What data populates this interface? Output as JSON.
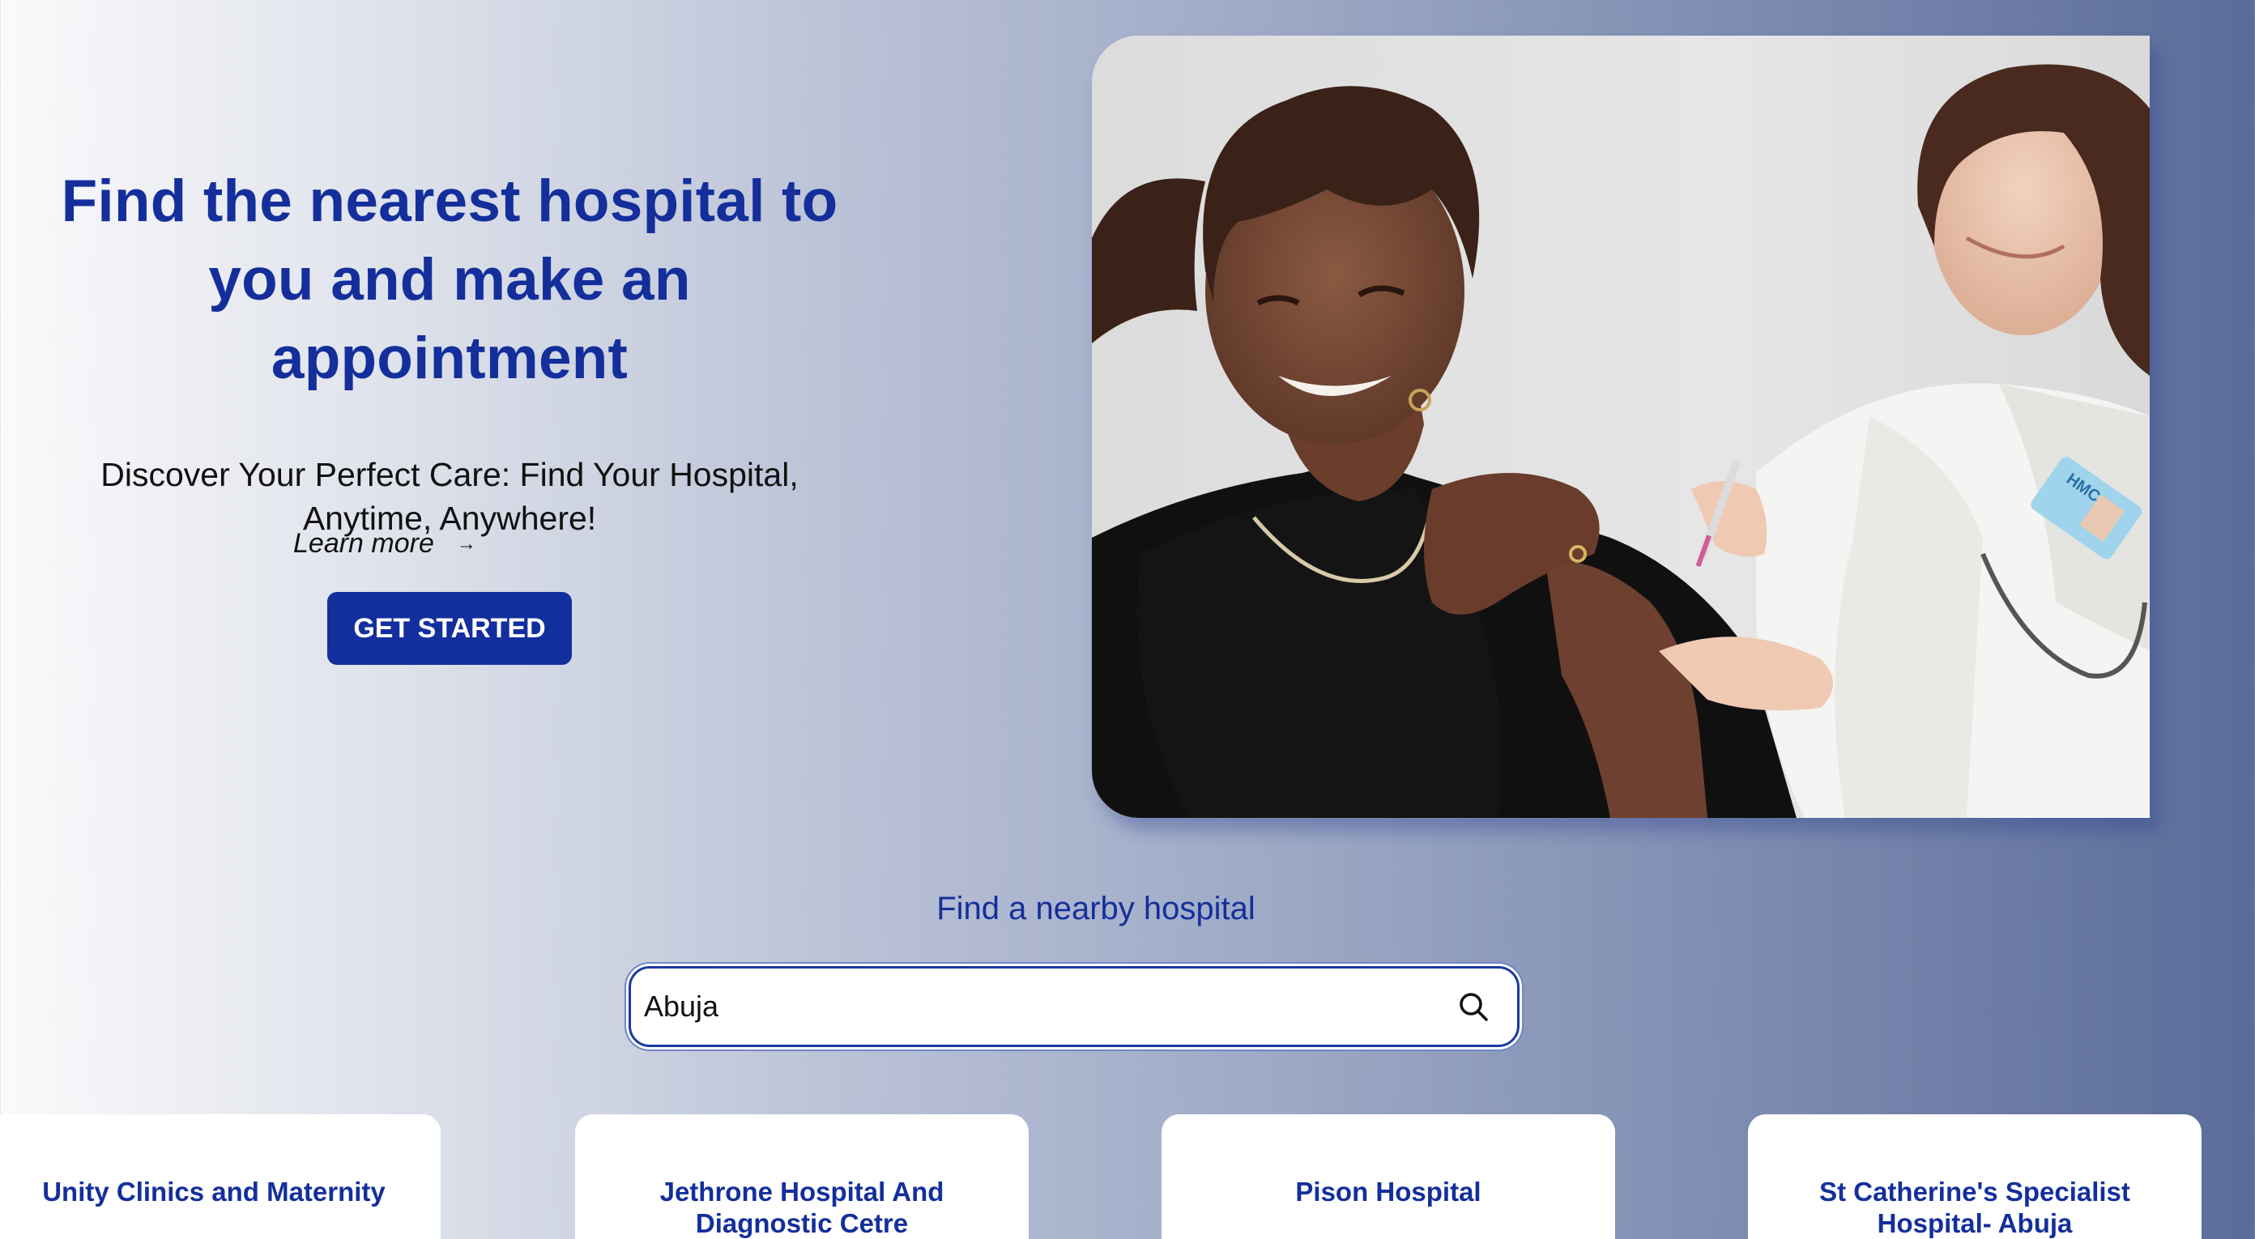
{
  "hero": {
    "title": "Find the nearest hospital to you and make an appointment",
    "subtitle": "Discover Your Perfect Care: Find Your Hospital, Anytime, Anywhere!",
    "cta_label": "GET STARTED",
    "learn_more_label": "Learn more",
    "learn_more_arrow": "→",
    "image_badge": "HMC"
  },
  "search": {
    "heading": "Find a nearby hospital",
    "value": "Abuja",
    "icon": "search-icon"
  },
  "hospitals": [
    {
      "name": "Unity Clinics and Maternity"
    },
    {
      "name": "Jethrone Hospital And Diagnostic Cetre"
    },
    {
      "name": "Pison Hospital"
    },
    {
      "name": "St Catherine's Specialist Hospital- Abuja"
    }
  ],
  "colors": {
    "brand": "#142f9b",
    "button": "#132f9e"
  }
}
